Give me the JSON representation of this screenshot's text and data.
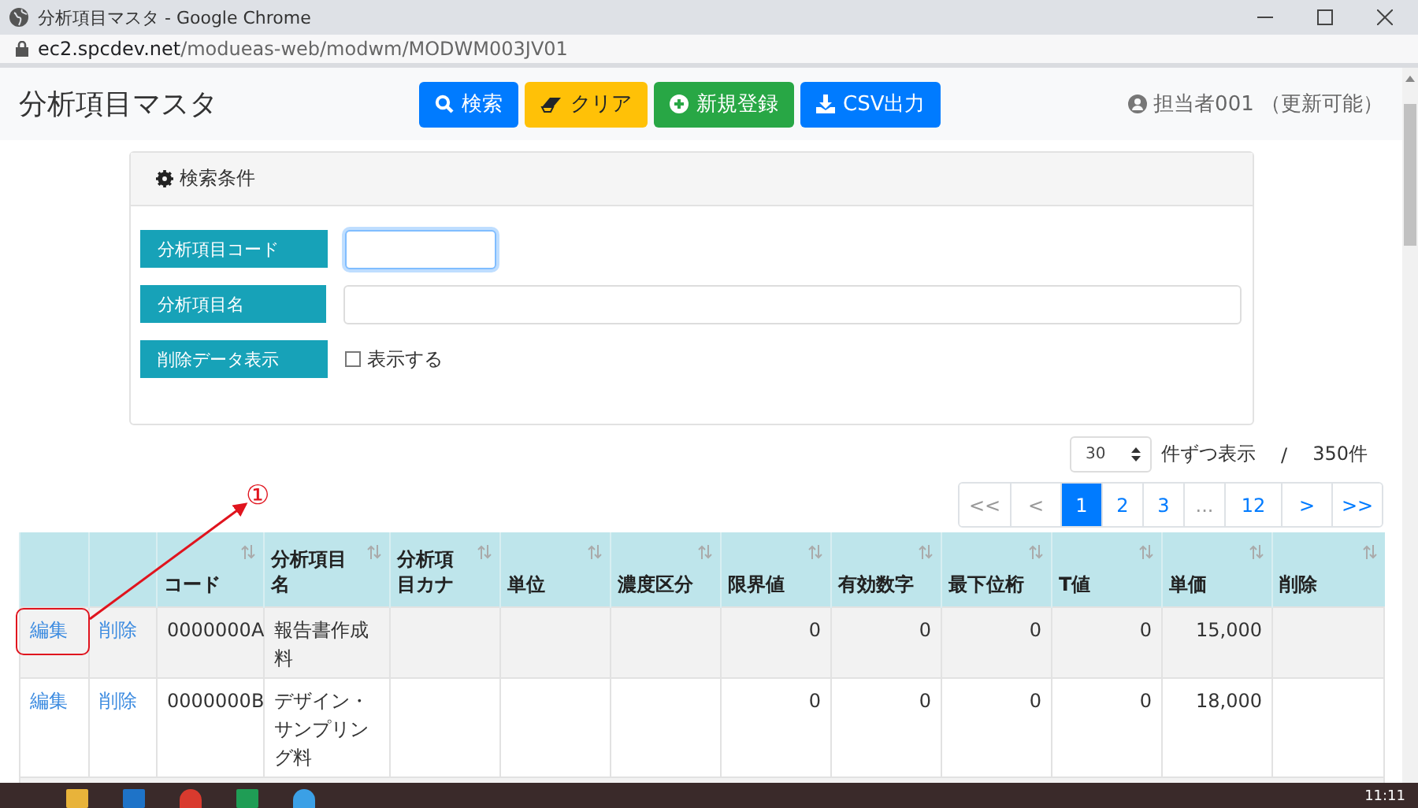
{
  "window": {
    "title": "分析項目マスタ - Google Chrome"
  },
  "address": {
    "host": "ec2.spcdev.net",
    "path": "/modueas-web/modwm/MODWM003JV01"
  },
  "header": {
    "title": "分析項目マスタ",
    "buttons": [
      {
        "label": "検索",
        "kind": "search"
      },
      {
        "label": "クリア",
        "kind": "clear"
      },
      {
        "label": "新規登録",
        "kind": "add"
      },
      {
        "label": "CSV出力",
        "kind": "download"
      }
    ],
    "user": "担当者001 （更新可能）"
  },
  "search_panel": {
    "title": "検索条件",
    "fields": [
      {
        "label": "分析項目コード",
        "kind": "text",
        "focused": true
      },
      {
        "label": "分析項目名",
        "kind": "text",
        "focused": false
      },
      {
        "label": "削除データ表示",
        "kind": "checkbox",
        "option": "表示する",
        "checked": false
      }
    ]
  },
  "paging": {
    "page_size": "30",
    "per_page_label": "件ずつ表示",
    "separator": "/",
    "total": "350件",
    "pages": [
      {
        "label": "<<",
        "selected": false
      },
      {
        "label": "<",
        "selected": false
      },
      {
        "label": "1",
        "selected": true
      },
      {
        "label": "2",
        "selected": false
      },
      {
        "label": "3",
        "selected": false
      },
      {
        "label": "...",
        "selected": false
      },
      {
        "label": "12",
        "selected": false
      },
      {
        "label": ">",
        "selected": false
      },
      {
        "label": ">>",
        "selected": false
      }
    ]
  },
  "table": {
    "columns": [
      {
        "sortable": false
      },
      {
        "sortable": false
      },
      {
        "label": "コード",
        "sortable": true
      },
      {
        "label": "分析項目名",
        "sortable": true
      },
      {
        "label": "分析項目カナ",
        "sortable": true
      },
      {
        "label": "単位",
        "sortable": true
      },
      {
        "label": "濃度区分",
        "sortable": true
      },
      {
        "label": "限界値",
        "sortable": true
      },
      {
        "label": "有効数字",
        "sortable": true
      },
      {
        "label": "最下位桁",
        "sortable": true
      },
      {
        "label": "T値",
        "sortable": true
      },
      {
        "label": "単価",
        "sortable": true
      },
      {
        "label": "削除",
        "sortable": true
      }
    ],
    "rows": [
      {
        "edit": "編集",
        "delete": "削除",
        "code": "0000000A",
        "name": "報告書作成料",
        "limit": "0",
        "significant": "0",
        "lowest_digit": "0",
        "t_value": "0",
        "price": "15,000",
        "highlighted": true
      },
      {
        "edit": "編集",
        "delete": "削除",
        "code": "0000000B",
        "name": "デザイン・サンプリング料",
        "limit": "0",
        "significant": "0",
        "lowest_digit": "0",
        "t_value": "0",
        "price": "18,000",
        "highlighted": false
      }
    ]
  },
  "annotation": {
    "label": "①"
  },
  "taskbar": {
    "clock": "11:11"
  }
}
